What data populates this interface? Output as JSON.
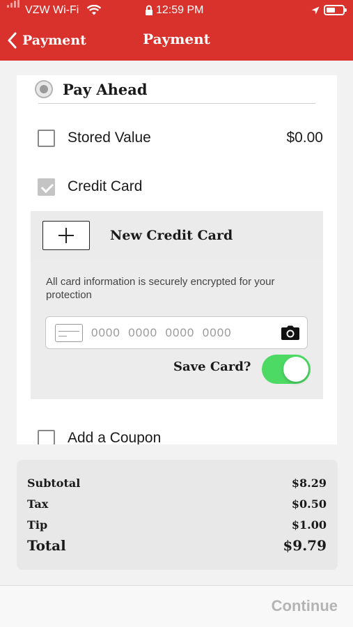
{
  "status_bar": {
    "carrier": "VZW Wi-Fi",
    "time": "12:59 PM"
  },
  "nav": {
    "back_label": "Payment",
    "title": "Payment"
  },
  "payment": {
    "pay_ahead_label": "Pay Ahead",
    "stored_value": {
      "label": "Stored Value",
      "amount": "$0.00",
      "checked": false
    },
    "credit_card": {
      "label": "Credit Card",
      "checked": true
    },
    "new_card_label": "New Credit Card",
    "secure_note": "All card information is securely encrypted for your protection",
    "card_number_placeholder": "0000  0000  0000  0000",
    "save_card_label": "Save Card?",
    "save_card_on": true,
    "coupon": {
      "label": "Add a Coupon",
      "checked": false
    }
  },
  "summary": {
    "subtotal_label": "Subtotal",
    "subtotal": "$8.29",
    "tax_label": "Tax",
    "tax": "$0.50",
    "tip_label": "Tip",
    "tip": "$1.00",
    "total_label": "Total",
    "total": "$9.79"
  },
  "footer": {
    "continue_label": "Continue"
  },
  "colors": {
    "brand_red": "#d9312c",
    "toggle_on": "#4cd964",
    "continue_disabled": "#b4b4b4"
  }
}
